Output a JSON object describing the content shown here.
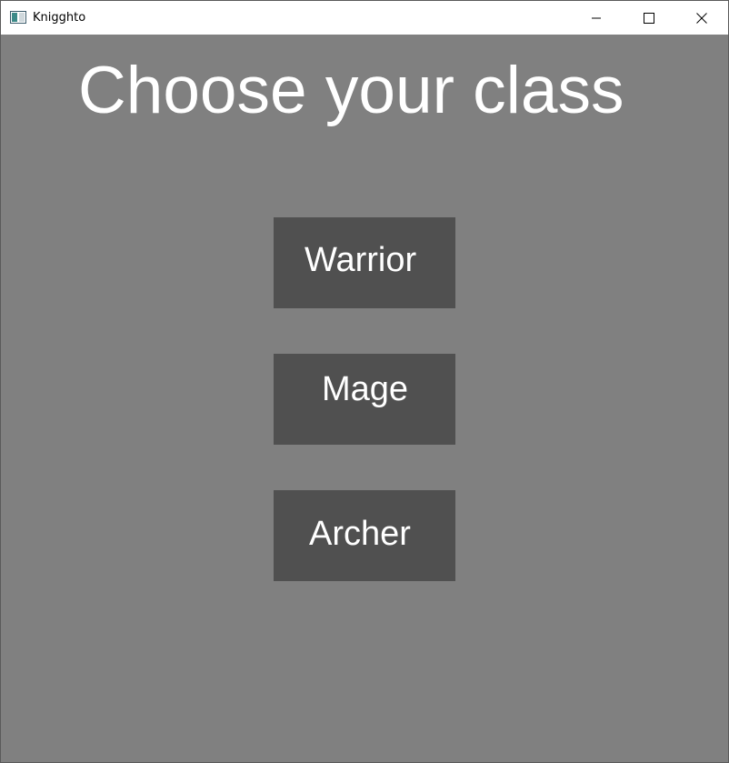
{
  "window": {
    "title": "Knigghto",
    "icon": "app-window-icon",
    "controls": {
      "minimize_icon": "minimize-icon",
      "maximize_icon": "maximize-icon",
      "close_icon": "close-icon"
    }
  },
  "screen": {
    "heading": "Choose your class",
    "background_color": "#808080",
    "button_color": "#505050",
    "text_color": "#ffffff",
    "classes": [
      {
        "label": "Warrior"
      },
      {
        "label": "Mage"
      },
      {
        "label": "Archer"
      }
    ]
  }
}
